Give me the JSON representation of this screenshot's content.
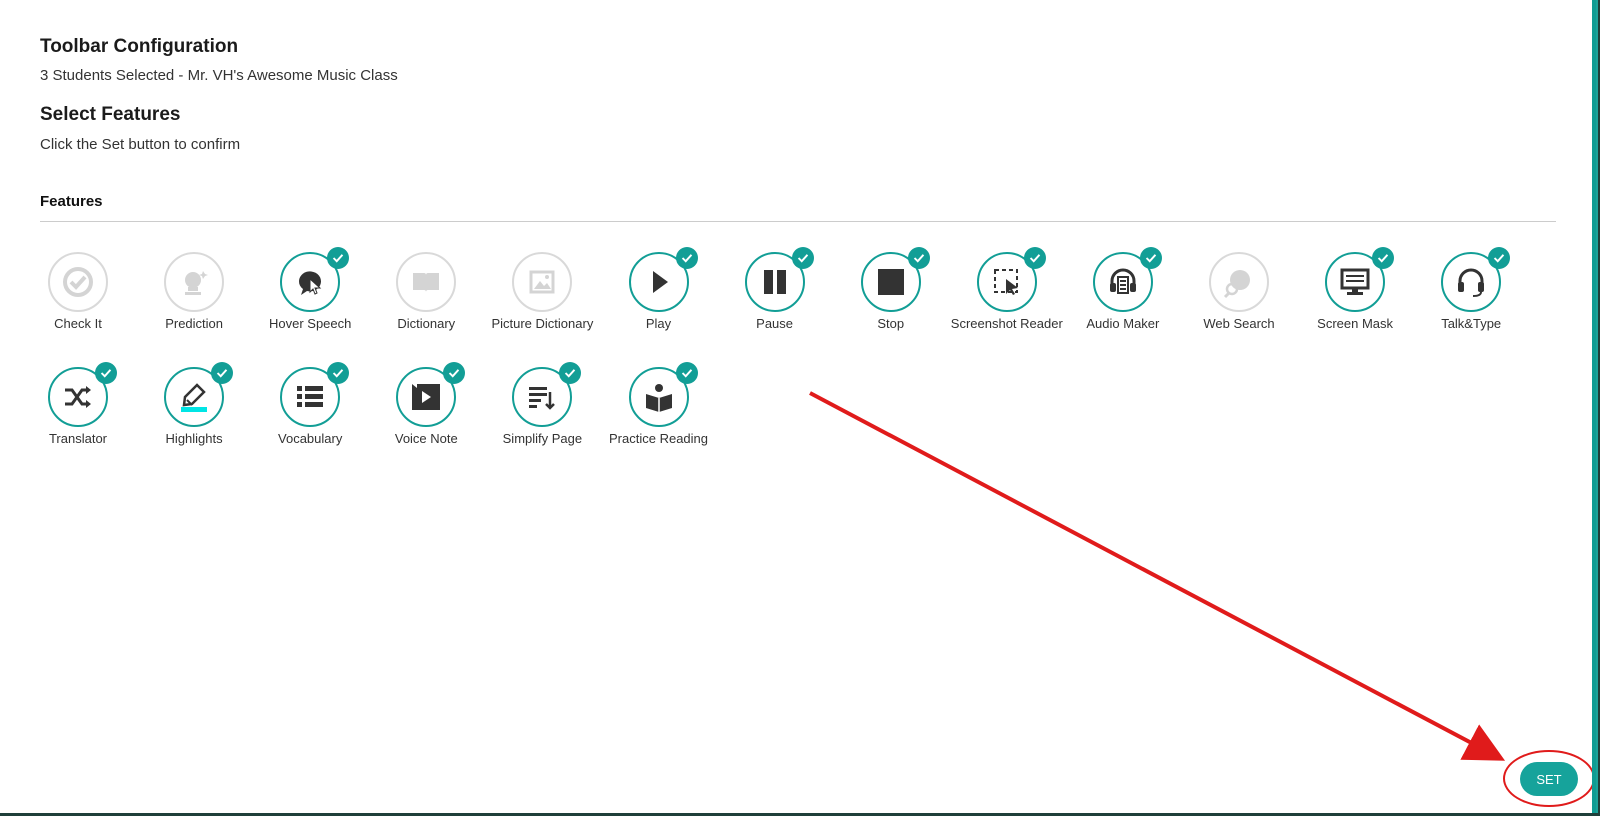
{
  "header": {
    "title": "Toolbar Configuration",
    "subtitle": "3 Students Selected - Mr. VH's Awesome Music Class"
  },
  "select": {
    "title": "Select Features",
    "hint": "Click the Set button to confirm"
  },
  "features_heading": "Features",
  "features": [
    {
      "label": "Check It",
      "icon": "check-it-icon",
      "enabled": false
    },
    {
      "label": "Prediction",
      "icon": "prediction-icon",
      "enabled": false
    },
    {
      "label": "Hover Speech",
      "icon": "hover-speech-icon",
      "enabled": true
    },
    {
      "label": "Dictionary",
      "icon": "dictionary-icon",
      "enabled": false
    },
    {
      "label": "Picture Dictionary",
      "icon": "picture-dictionary-icon",
      "enabled": false
    },
    {
      "label": "Play",
      "icon": "play-icon",
      "enabled": true
    },
    {
      "label": "Pause",
      "icon": "pause-icon",
      "enabled": true
    },
    {
      "label": "Stop",
      "icon": "stop-icon",
      "enabled": true
    },
    {
      "label": "Screenshot Reader",
      "icon": "screenshot-reader-icon",
      "enabled": true
    },
    {
      "label": "Audio Maker",
      "icon": "audio-maker-icon",
      "enabled": true
    },
    {
      "label": "Web Search",
      "icon": "web-search-icon",
      "enabled": false
    },
    {
      "label": "Screen Mask",
      "icon": "screen-mask-icon",
      "enabled": true
    },
    {
      "label": "Talk&Type",
      "icon": "talk-type-icon",
      "enabled": true
    },
    {
      "label": "Translator",
      "icon": "translator-icon",
      "enabled": true
    },
    {
      "label": "Highlights",
      "icon": "highlights-icon",
      "enabled": true
    },
    {
      "label": "Vocabulary",
      "icon": "vocabulary-icon",
      "enabled": true
    },
    {
      "label": "Voice Note",
      "icon": "voice-note-icon",
      "enabled": true
    },
    {
      "label": "Simplify Page",
      "icon": "simplify-page-icon",
      "enabled": true
    },
    {
      "label": "Practice Reading",
      "icon": "practice-reading-icon",
      "enabled": true
    }
  ],
  "set_button": "SET",
  "colors": {
    "accent": "#129e96",
    "disabled": "#d9d9d9",
    "annotation": "#e01b1b"
  }
}
